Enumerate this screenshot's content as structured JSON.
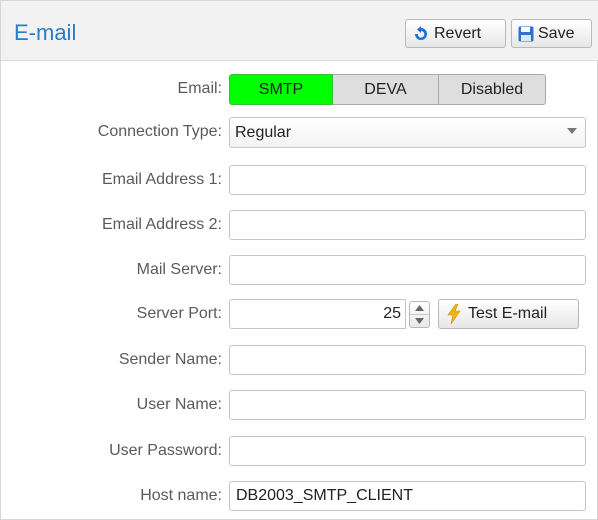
{
  "header": {
    "title": "E-mail",
    "revert_label": "Revert",
    "save_label": "Save"
  },
  "form": {
    "email": {
      "label": "Email:",
      "options": [
        "SMTP",
        "DEVA",
        "Disabled"
      ],
      "selected": "SMTP"
    },
    "connection_type": {
      "label": "Connection Type:",
      "value": "Regular"
    },
    "email_address_1": {
      "label": "Email Address 1:",
      "value": ""
    },
    "email_address_2": {
      "label": "Email Address 2:",
      "value": ""
    },
    "mail_server": {
      "label": "Mail Server:",
      "value": ""
    },
    "server_port": {
      "label": "Server Port:",
      "value": "25",
      "test_button_label": "Test E-mail"
    },
    "sender_name": {
      "label": "Sender Name:",
      "value": ""
    },
    "user_name": {
      "label": "User Name:",
      "value": ""
    },
    "user_password": {
      "label": "User Password:",
      "value": ""
    },
    "host_name": {
      "label": "Host name:",
      "value": "DB2003_SMTP_CLIENT"
    }
  },
  "colors": {
    "title": "#2a7cc4",
    "selected_segment": "#00ff00",
    "label": "#5a5a5a"
  }
}
